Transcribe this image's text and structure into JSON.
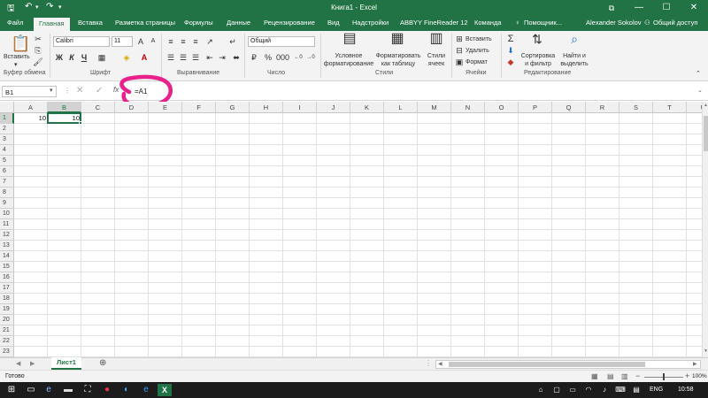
{
  "title": "Книга1 - Excel",
  "window_controls": {
    "restore": "⧉",
    "minimize": "—",
    "maximize": "☐",
    "close": "✕"
  },
  "tabs": [
    {
      "label": "Файл"
    },
    {
      "label": "Главная",
      "active": true
    },
    {
      "label": "Вставка"
    },
    {
      "label": "Разметка страницы"
    },
    {
      "label": "Формулы"
    },
    {
      "label": "Данные"
    },
    {
      "label": "Рецензирование"
    },
    {
      "label": "Вид"
    },
    {
      "label": "Надстройки"
    },
    {
      "label": "ABBYY FineReader 12"
    },
    {
      "label": "Команда"
    }
  ],
  "search_placeholder": "Помощник...",
  "user": "Alexander Sokolov",
  "share": "Общий доступ",
  "ribbon": {
    "clipboard": {
      "paste": "Вставить",
      "label": "Буфер обмена"
    },
    "font": {
      "name": "Calibri",
      "size": "11",
      "bold": "Ж",
      "italic": "К",
      "underline": "Ч",
      "label": "Шрифт"
    },
    "alignment": {
      "label": "Выравнивание"
    },
    "number": {
      "format": "Общий",
      "label": "Число"
    },
    "styles": {
      "conditional": "Условное форматирование",
      "table": "Форматировать как таблицу",
      "cell": "Стили ячеек",
      "label": "Стили"
    },
    "cells": {
      "insert": "Вставить",
      "delete": "Удалить",
      "format": "Формат",
      "label": "Ячейки"
    },
    "editing": {
      "sort": "Сортировка и фильтр",
      "find": "Найти и выделить",
      "label": "Редактирование"
    }
  },
  "formula_bar": {
    "name_box": "B1",
    "formula": "=A1",
    "highlight_color": "#e8228a"
  },
  "columns": [
    "A",
    "B",
    "C",
    "D",
    "E",
    "F",
    "G",
    "H",
    "I",
    "J",
    "K",
    "L",
    "M",
    "N",
    "O",
    "P",
    "Q",
    "R",
    "S",
    "T",
    "U"
  ],
  "rows": [
    "1",
    "2",
    "3",
    "4",
    "5",
    "6",
    "7",
    "8",
    "9",
    "10",
    "11",
    "12",
    "13",
    "14",
    "15",
    "16",
    "17",
    "18",
    "19",
    "20",
    "21",
    "22",
    "23"
  ],
  "cells": {
    "A1": "10",
    "B1": "10"
  },
  "sheet_tab": "Лист1",
  "status": {
    "ready": "Готово",
    "zoom": "100%"
  },
  "taskbar": {
    "lang": "ENG",
    "time": "10:58"
  }
}
